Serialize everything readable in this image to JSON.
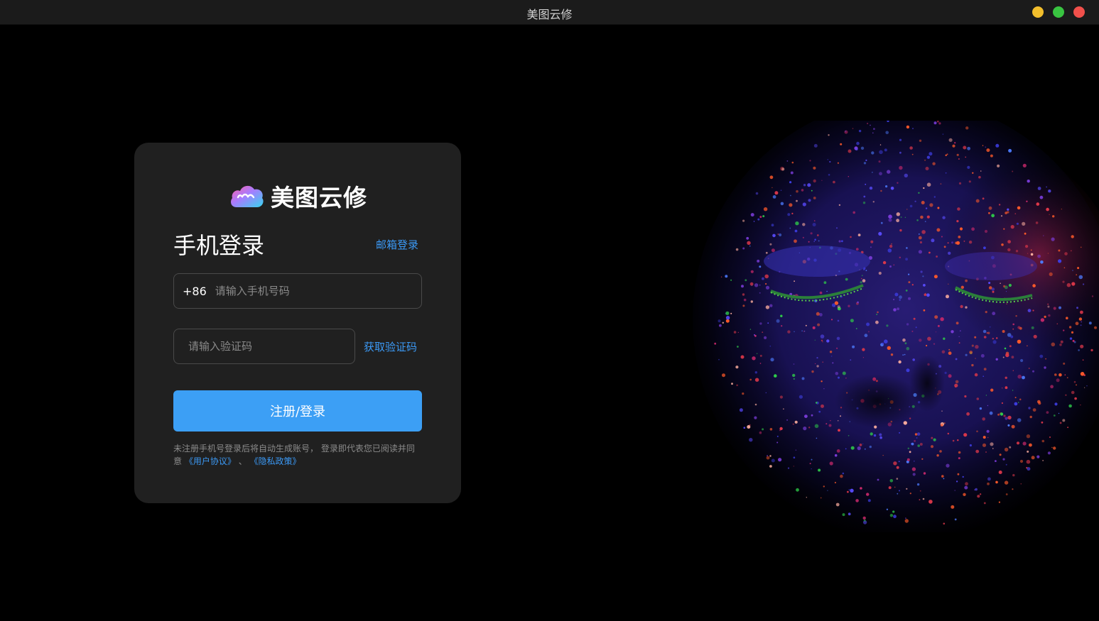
{
  "window": {
    "title": "美图云修"
  },
  "colors": {
    "accent": "#3c9ff5",
    "card_bg": "#202020",
    "minimize": "#f2be2c",
    "maximize": "#39c441",
    "close": "#f1504b"
  },
  "logo": {
    "text": "美图云修",
    "icon": "cloud-logo-icon"
  },
  "login": {
    "heading": "手机登录",
    "email_login_link": "邮箱登录",
    "country_code": "+86",
    "phone_placeholder": "请输入手机号码",
    "code_placeholder": "请输入验证码",
    "get_code_button": "获取验证码",
    "submit_button": "注册/登录",
    "notice_text": "未注册手机号登录后将自动生成账号， 登录即代表您已阅读并同意",
    "user_agreement": "《用户协议》",
    "separator": "、",
    "privacy_policy": "《隐私政策》"
  },
  "hero": {
    "image": "neon-paint-face"
  }
}
